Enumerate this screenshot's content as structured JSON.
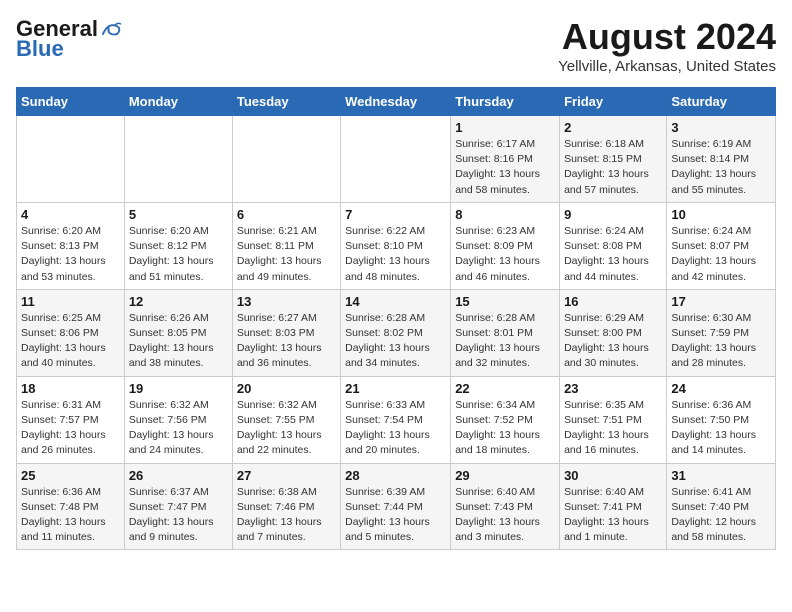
{
  "logo": {
    "general": "General",
    "blue": "Blue"
  },
  "title": "August 2024",
  "location": "Yellville, Arkansas, United States",
  "weekdays": [
    "Sunday",
    "Monday",
    "Tuesday",
    "Wednesday",
    "Thursday",
    "Friday",
    "Saturday"
  ],
  "weeks": [
    [
      {
        "day": "",
        "info": ""
      },
      {
        "day": "",
        "info": ""
      },
      {
        "day": "",
        "info": ""
      },
      {
        "day": "",
        "info": ""
      },
      {
        "day": "1",
        "info": "Sunrise: 6:17 AM\nSunset: 8:16 PM\nDaylight: 13 hours\nand 58 minutes."
      },
      {
        "day": "2",
        "info": "Sunrise: 6:18 AM\nSunset: 8:15 PM\nDaylight: 13 hours\nand 57 minutes."
      },
      {
        "day": "3",
        "info": "Sunrise: 6:19 AM\nSunset: 8:14 PM\nDaylight: 13 hours\nand 55 minutes."
      }
    ],
    [
      {
        "day": "4",
        "info": "Sunrise: 6:20 AM\nSunset: 8:13 PM\nDaylight: 13 hours\nand 53 minutes."
      },
      {
        "day": "5",
        "info": "Sunrise: 6:20 AM\nSunset: 8:12 PM\nDaylight: 13 hours\nand 51 minutes."
      },
      {
        "day": "6",
        "info": "Sunrise: 6:21 AM\nSunset: 8:11 PM\nDaylight: 13 hours\nand 49 minutes."
      },
      {
        "day": "7",
        "info": "Sunrise: 6:22 AM\nSunset: 8:10 PM\nDaylight: 13 hours\nand 48 minutes."
      },
      {
        "day": "8",
        "info": "Sunrise: 6:23 AM\nSunset: 8:09 PM\nDaylight: 13 hours\nand 46 minutes."
      },
      {
        "day": "9",
        "info": "Sunrise: 6:24 AM\nSunset: 8:08 PM\nDaylight: 13 hours\nand 44 minutes."
      },
      {
        "day": "10",
        "info": "Sunrise: 6:24 AM\nSunset: 8:07 PM\nDaylight: 13 hours\nand 42 minutes."
      }
    ],
    [
      {
        "day": "11",
        "info": "Sunrise: 6:25 AM\nSunset: 8:06 PM\nDaylight: 13 hours\nand 40 minutes."
      },
      {
        "day": "12",
        "info": "Sunrise: 6:26 AM\nSunset: 8:05 PM\nDaylight: 13 hours\nand 38 minutes."
      },
      {
        "day": "13",
        "info": "Sunrise: 6:27 AM\nSunset: 8:03 PM\nDaylight: 13 hours\nand 36 minutes."
      },
      {
        "day": "14",
        "info": "Sunrise: 6:28 AM\nSunset: 8:02 PM\nDaylight: 13 hours\nand 34 minutes."
      },
      {
        "day": "15",
        "info": "Sunrise: 6:28 AM\nSunset: 8:01 PM\nDaylight: 13 hours\nand 32 minutes."
      },
      {
        "day": "16",
        "info": "Sunrise: 6:29 AM\nSunset: 8:00 PM\nDaylight: 13 hours\nand 30 minutes."
      },
      {
        "day": "17",
        "info": "Sunrise: 6:30 AM\nSunset: 7:59 PM\nDaylight: 13 hours\nand 28 minutes."
      }
    ],
    [
      {
        "day": "18",
        "info": "Sunrise: 6:31 AM\nSunset: 7:57 PM\nDaylight: 13 hours\nand 26 minutes."
      },
      {
        "day": "19",
        "info": "Sunrise: 6:32 AM\nSunset: 7:56 PM\nDaylight: 13 hours\nand 24 minutes."
      },
      {
        "day": "20",
        "info": "Sunrise: 6:32 AM\nSunset: 7:55 PM\nDaylight: 13 hours\nand 22 minutes."
      },
      {
        "day": "21",
        "info": "Sunrise: 6:33 AM\nSunset: 7:54 PM\nDaylight: 13 hours\nand 20 minutes."
      },
      {
        "day": "22",
        "info": "Sunrise: 6:34 AM\nSunset: 7:52 PM\nDaylight: 13 hours\nand 18 minutes."
      },
      {
        "day": "23",
        "info": "Sunrise: 6:35 AM\nSunset: 7:51 PM\nDaylight: 13 hours\nand 16 minutes."
      },
      {
        "day": "24",
        "info": "Sunrise: 6:36 AM\nSunset: 7:50 PM\nDaylight: 13 hours\nand 14 minutes."
      }
    ],
    [
      {
        "day": "25",
        "info": "Sunrise: 6:36 AM\nSunset: 7:48 PM\nDaylight: 13 hours\nand 11 minutes."
      },
      {
        "day": "26",
        "info": "Sunrise: 6:37 AM\nSunset: 7:47 PM\nDaylight: 13 hours\nand 9 minutes."
      },
      {
        "day": "27",
        "info": "Sunrise: 6:38 AM\nSunset: 7:46 PM\nDaylight: 13 hours\nand 7 minutes."
      },
      {
        "day": "28",
        "info": "Sunrise: 6:39 AM\nSunset: 7:44 PM\nDaylight: 13 hours\nand 5 minutes."
      },
      {
        "day": "29",
        "info": "Sunrise: 6:40 AM\nSunset: 7:43 PM\nDaylight: 13 hours\nand 3 minutes."
      },
      {
        "day": "30",
        "info": "Sunrise: 6:40 AM\nSunset: 7:41 PM\nDaylight: 13 hours\nand 1 minute."
      },
      {
        "day": "31",
        "info": "Sunrise: 6:41 AM\nSunset: 7:40 PM\nDaylight: 12 hours\nand 58 minutes."
      }
    ]
  ]
}
